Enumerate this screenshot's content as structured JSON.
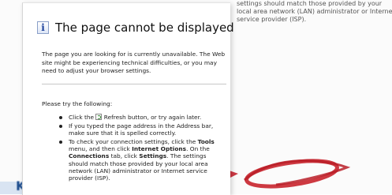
{
  "background": {
    "lines": [
      "settings should match those provided by your",
      "local area network (LAN) administrator or Internet",
      "service provider (ISP)."
    ],
    "logo_text": "Kros"
  },
  "panel": {
    "title": "The page cannot be displayed",
    "intro": "The page you are looking for is currently unavailable. The Web site might be experiencing technical difficulties, or you may need to adjust your browser settings.",
    "try_heading": "Please try the following:",
    "step1_a": "Click the ",
    "step1_b": " Refresh button, or try again later.",
    "step2": "If you typed the page address in the Address bar, make sure that it is spelled correctly.",
    "step3_a": "To check your connection settings, click the ",
    "step3_tools": "Tools",
    "step3_b": " menu, and then click ",
    "step3_options": "Internet Options",
    "step3_c": ". On the ",
    "step3_connections": "Connections",
    "step3_d": " tab, click ",
    "step3_settings": "Settings",
    "step3_e": ". The settings should match those provided by your local area network (LAN) administrator or Internet service provider (ISP)."
  }
}
